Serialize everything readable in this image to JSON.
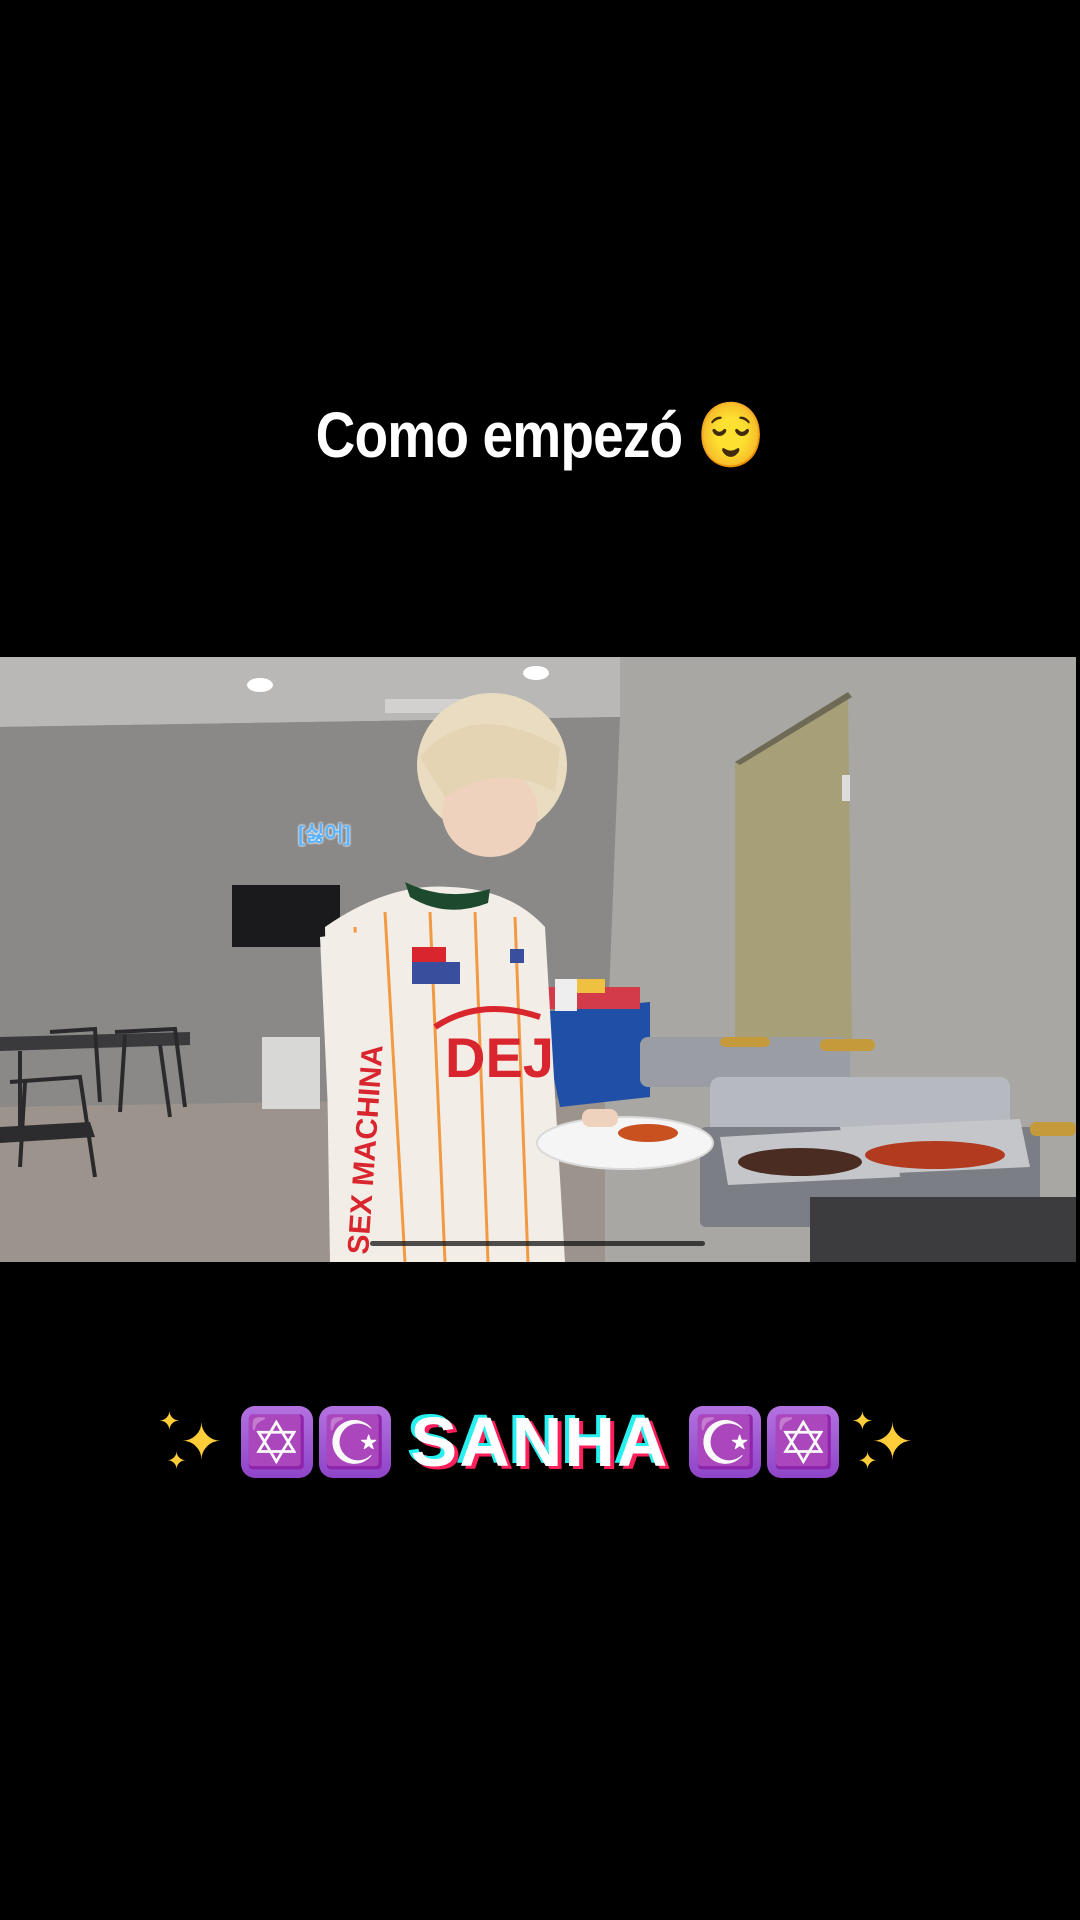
{
  "caption": {
    "text": "Como empezó",
    "emoji": "😌"
  },
  "video": {
    "subtitle": "[싫어]",
    "jersey_word": "DEJ",
    "sleeve_word": "SEX MACHINA"
  },
  "banner": {
    "name": "SANHA",
    "left_emojis": [
      "✡️",
      "☪️"
    ],
    "right_emojis": [
      "☪️",
      "✡️"
    ],
    "sparkle_icon": "sparkles-icon",
    "colors": {
      "text_cyan": "#27f0ee",
      "text_pink": "#ff1f5a",
      "emoji_purple": "#9b51d6"
    }
  }
}
